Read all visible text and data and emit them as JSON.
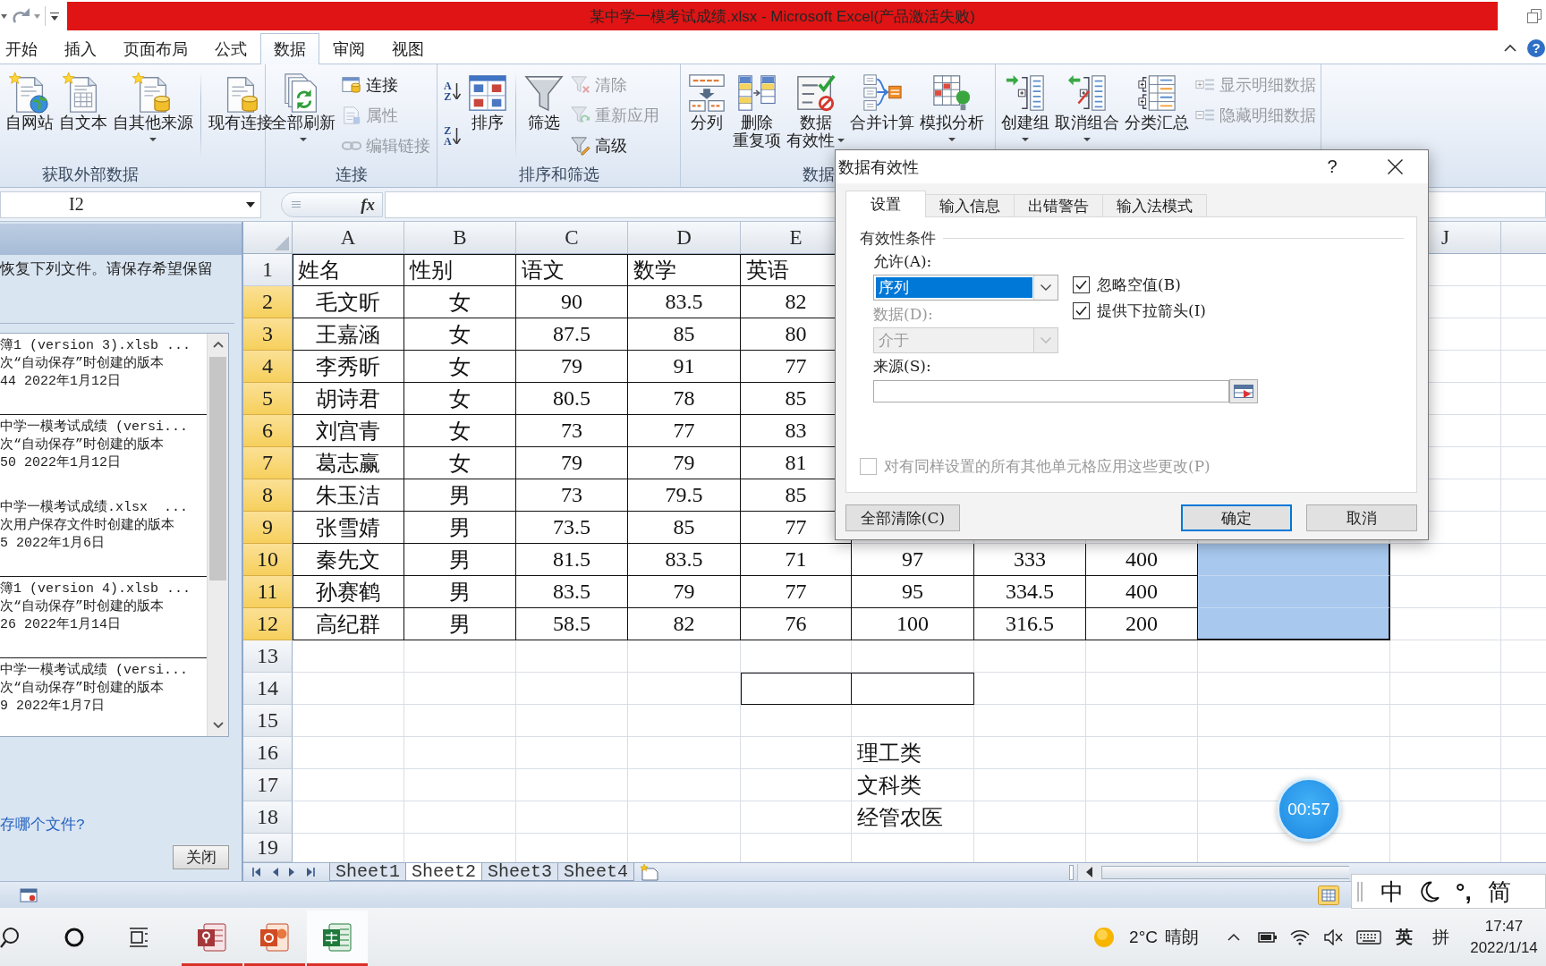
{
  "window": {
    "title": "某中学一模考试成绩.xlsx - Microsoft Excel(产品激活失败)"
  },
  "menu_bar": {
    "tabs": [
      {
        "label": "开始",
        "selected": false
      },
      {
        "label": "插入",
        "selected": false
      },
      {
        "label": "页面布局",
        "selected": false
      },
      {
        "label": "公式",
        "selected": false
      },
      {
        "label": "数据",
        "selected": true
      },
      {
        "label": "审阅",
        "selected": false
      },
      {
        "label": "视图",
        "selected": false
      }
    ],
    "help_button": "?"
  },
  "ribbon": {
    "groups": [
      {
        "label": "获取外部数据",
        "items": [
          {
            "kind": "large",
            "lines": [
              "自网站"
            ],
            "menu": false
          },
          {
            "kind": "large",
            "lines": [
              "自文本"
            ],
            "menu": false
          },
          {
            "kind": "large",
            "lines": [
              "自其他来源"
            ],
            "menu": true
          },
          {
            "kind": "separator"
          },
          {
            "kind": "large",
            "lines": [
              "现有连接"
            ],
            "menu": false
          }
        ]
      },
      {
        "label": "连接",
        "items": [
          {
            "kind": "large",
            "lines": [
              "全部刷新"
            ],
            "menu": true
          },
          {
            "kind": "stack",
            "buttons": [
              {
                "label": "连接",
                "disabled": false
              },
              {
                "label": "属性",
                "disabled": true
              },
              {
                "label": "编辑链接",
                "disabled": true
              }
            ]
          }
        ]
      },
      {
        "label": "排序和筛选",
        "items": [
          {
            "kind": "sort",
            "buttons": [
              {
                "letters": [
                  "A",
                  "Z"
                ]
              },
              {
                "letters": [
                  "Z",
                  "A"
                ]
              }
            ]
          },
          {
            "kind": "large",
            "lines": [
              "排序"
            ],
            "menu": false
          },
          {
            "kind": "separator"
          },
          {
            "kind": "large",
            "lines": [
              "筛选"
            ],
            "menu": false
          },
          {
            "kind": "stack",
            "buttons": [
              {
                "label": "清除",
                "disabled": true
              },
              {
                "label": "重新应用",
                "disabled": true
              },
              {
                "label": "高级",
                "disabled": false
              }
            ]
          }
        ]
      },
      {
        "label": "数据",
        "items": [
          {
            "kind": "large",
            "lines": [
              "分列"
            ],
            "menu": false
          },
          {
            "kind": "large",
            "lines": [
              "删除",
              "重复项"
            ],
            "menu": false
          },
          {
            "kind": "large",
            "lines": [
              "数据",
              "有效性"
            ],
            "menu": true
          },
          {
            "kind": "large",
            "lines": [
              "合并计算"
            ],
            "menu": false
          },
          {
            "kind": "large",
            "lines": [
              "模拟分析"
            ],
            "menu": true
          }
        ]
      },
      {
        "items": [
          {
            "kind": "large",
            "lines": [
              "创建组"
            ],
            "menu": true
          },
          {
            "kind": "large",
            "lines": [
              "取消组合"
            ],
            "menu": true
          },
          {
            "kind": "large",
            "lines": [
              "分类汇总"
            ],
            "menu": false
          },
          {
            "kind": "stack",
            "buttons": [
              {
                "label": "显示明细数据",
                "disabled": true
              },
              {
                "label": "隐藏明细数据",
                "disabled": true
              }
            ]
          }
        ]
      }
    ]
  },
  "formula_bar": {
    "name_box": "I2",
    "function_button": "fx"
  },
  "recovery_pane": {
    "message": "恢复下列文件。请保存希望保留",
    "file_groups": [
      {
        "files": [
          {
            "name": "簿1 (version 3).xlsb ...",
            "note": "次“自动保存”时创建的版本",
            "time": "44 2022年1月12日"
          }
        ]
      },
      {
        "files": [
          {
            "name": "中学一模考试成绩 (versi...",
            "note": "次“自动保存”时创建的版本",
            "time": "50 2022年1月12日"
          },
          {
            "name": "中学一模考试成绩.xlsx  ...",
            "note": "次用户保存文件时创建的版本",
            "time": "5 2022年1月6日"
          }
        ]
      },
      {
        "files": [
          {
            "name": "簿1 (version 4).xlsb ...",
            "note": "次“自动保存”时创建的版本",
            "time": "26 2022年1月14日"
          }
        ]
      },
      {
        "files": [
          {
            "name": "中学一模考试成绩 (versi...",
            "note": "次“自动保存”时创建的版本",
            "time": "9 2022年1月7日"
          }
        ]
      }
    ],
    "question": "存哪个文件?",
    "close_button": "关闭"
  },
  "sheet": {
    "column_headers": [
      "A",
      "B",
      "C",
      "D",
      "E"
    ],
    "column_headers_right": [
      "J"
    ],
    "rows": [
      {
        "number": "1",
        "selected": false,
        "cells": [
          "姓名",
          "性别",
          "语文",
          "数学",
          "英语"
        ]
      },
      {
        "number": "2",
        "selected": true,
        "cells": [
          "毛文昕",
          "女",
          "90",
          "83.5",
          "82"
        ]
      },
      {
        "number": "3",
        "selected": true,
        "cells": [
          "王嘉涵",
          "女",
          "87.5",
          "85",
          "80"
        ]
      },
      {
        "number": "4",
        "selected": true,
        "cells": [
          "李秀昕",
          "女",
          "79",
          "91",
          "77"
        ]
      },
      {
        "number": "5",
        "selected": true,
        "cells": [
          "胡诗君",
          "女",
          "80.5",
          "78",
          "85"
        ]
      },
      {
        "number": "6",
        "selected": true,
        "cells": [
          "刘宫青",
          "女",
          "73",
          "77",
          "83"
        ]
      },
      {
        "number": "7",
        "selected": true,
        "cells": [
          "葛志赢",
          "女",
          "79",
          "79",
          "81"
        ]
      },
      {
        "number": "8",
        "selected": true,
        "cells": [
          "朱玉洁",
          "男",
          "73",
          "79.5",
          "85"
        ]
      },
      {
        "number": "9",
        "selected": true,
        "cells": [
          "张雪婧",
          "男",
          "73.5",
          "85",
          "77"
        ]
      },
      {
        "number": "10",
        "selected": true,
        "cells": [
          "秦先文",
          "男",
          "81.5",
          "83.5",
          "71",
          "97",
          "333",
          "400"
        ]
      },
      {
        "number": "11",
        "selected": true,
        "cells": [
          "孙赛鹤",
          "男",
          "83.5",
          "79",
          "77",
          "95",
          "334.5",
          "400"
        ]
      },
      {
        "number": "12",
        "selected": true,
        "cells": [
          "高纪群",
          "男",
          "58.5",
          "82",
          "76",
          "100",
          "316.5",
          "200"
        ]
      },
      {
        "number": "13",
        "selected": false
      },
      {
        "number": "14",
        "selected": false
      },
      {
        "number": "15",
        "selected": false
      },
      {
        "number": "16",
        "selected": false
      },
      {
        "number": "17",
        "selected": false
      },
      {
        "number": "18",
        "selected": false
      },
      {
        "number": "19",
        "selected": false
      }
    ],
    "category_list": [
      "理工类",
      "文科类",
      "经管农医"
    ]
  },
  "sheet_tabs": [
    {
      "label": "Sheet1",
      "selected": false
    },
    {
      "label": "Sheet2",
      "selected": true
    },
    {
      "label": "Sheet3",
      "selected": false
    },
    {
      "label": "Sheet4",
      "selected": false
    }
  ],
  "dialog": {
    "title": "数据有效性",
    "help_button": "?",
    "tabs": [
      {
        "label": "设置",
        "selected": true
      },
      {
        "label": "输入信息",
        "selected": false
      },
      {
        "label": "出错警告",
        "selected": false
      },
      {
        "label": "输入法模式",
        "selected": false
      }
    ],
    "section_title": "有效性条件",
    "allow": {
      "label": "允许(A):",
      "value": "序列",
      "focused": true,
      "disabled": false
    },
    "data": {
      "label": "数据(D):",
      "value": "介于",
      "focused": false,
      "disabled": true
    },
    "source": {
      "label": "来源(S):"
    },
    "options": [
      {
        "label": "忽略空值(B)",
        "checked": true,
        "disabled": false
      },
      {
        "label": "提供下拉箭头(I)",
        "checked": true,
        "disabled": false
      }
    ],
    "apply_all": {
      "label": "对有同样设置的所有其他单元格应用这些更改(P)",
      "checked": false,
      "disabled": true
    },
    "clear_button": "全部清除(C)",
    "buttons": [
      {
        "label": "确定",
        "default": true
      },
      {
        "label": "取消",
        "default": false
      }
    ]
  },
  "ime_bar": {
    "mode": "中",
    "punctuation": "°,",
    "script": "简"
  },
  "recording_timer": "00:57",
  "taskbar": {
    "apps": [
      {
        "active": false
      },
      {
        "active": false
      },
      {
        "active": true
      }
    ],
    "temperature": "2°C",
    "weather": "晴朗",
    "input_language": "英",
    "ime_mode": "拼",
    "time": "17:47",
    "date": "2022/1/14"
  }
}
